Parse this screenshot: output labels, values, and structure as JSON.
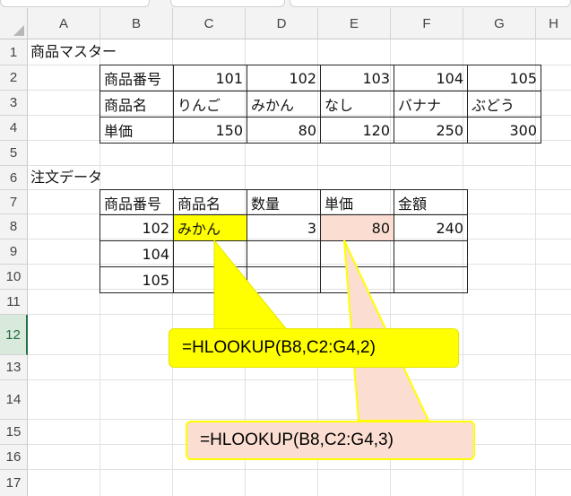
{
  "columns": [
    "A",
    "B",
    "C",
    "D",
    "E",
    "F",
    "G",
    "H"
  ],
  "rows": [
    "1",
    "2",
    "3",
    "4",
    "5",
    "6",
    "7",
    "8",
    "9",
    "10",
    "11",
    "12",
    "13",
    "14",
    "15",
    "16",
    "17"
  ],
  "selected_row": "12",
  "master": {
    "title": "商品マスター",
    "rows": [
      {
        "label": "商品番号",
        "values": [
          "101",
          "102",
          "103",
          "104",
          "105"
        ]
      },
      {
        "label": "商品名",
        "values": [
          "りんご",
          "みかん",
          "なし",
          "バナナ",
          "ぶどう"
        ]
      },
      {
        "label": "単価",
        "values": [
          "150",
          "80",
          "120",
          "250",
          "300"
        ]
      }
    ]
  },
  "orders": {
    "title": "注文データ",
    "headers": [
      "商品番号",
      "商品名",
      "数量",
      "単価",
      "金額"
    ],
    "rows": [
      [
        "102",
        "みかん",
        "3",
        "80",
        "240"
      ],
      [
        "104",
        "",
        "",
        "",
        ""
      ],
      [
        "105",
        "",
        "",
        "",
        ""
      ]
    ]
  },
  "callouts": [
    {
      "text": "=HLOOKUP(B8,C2:G4,2)",
      "fill": "#ffff00",
      "border": "#e6e600"
    },
    {
      "text": "=HLOOKUP(B8,C2:G4,3)",
      "fill": "#fbded1",
      "border": "#ffff00"
    }
  ],
  "colors": {
    "highlight_yellow": "#ffff00",
    "highlight_peach": "#fbded1",
    "selected_row": "#217346"
  }
}
